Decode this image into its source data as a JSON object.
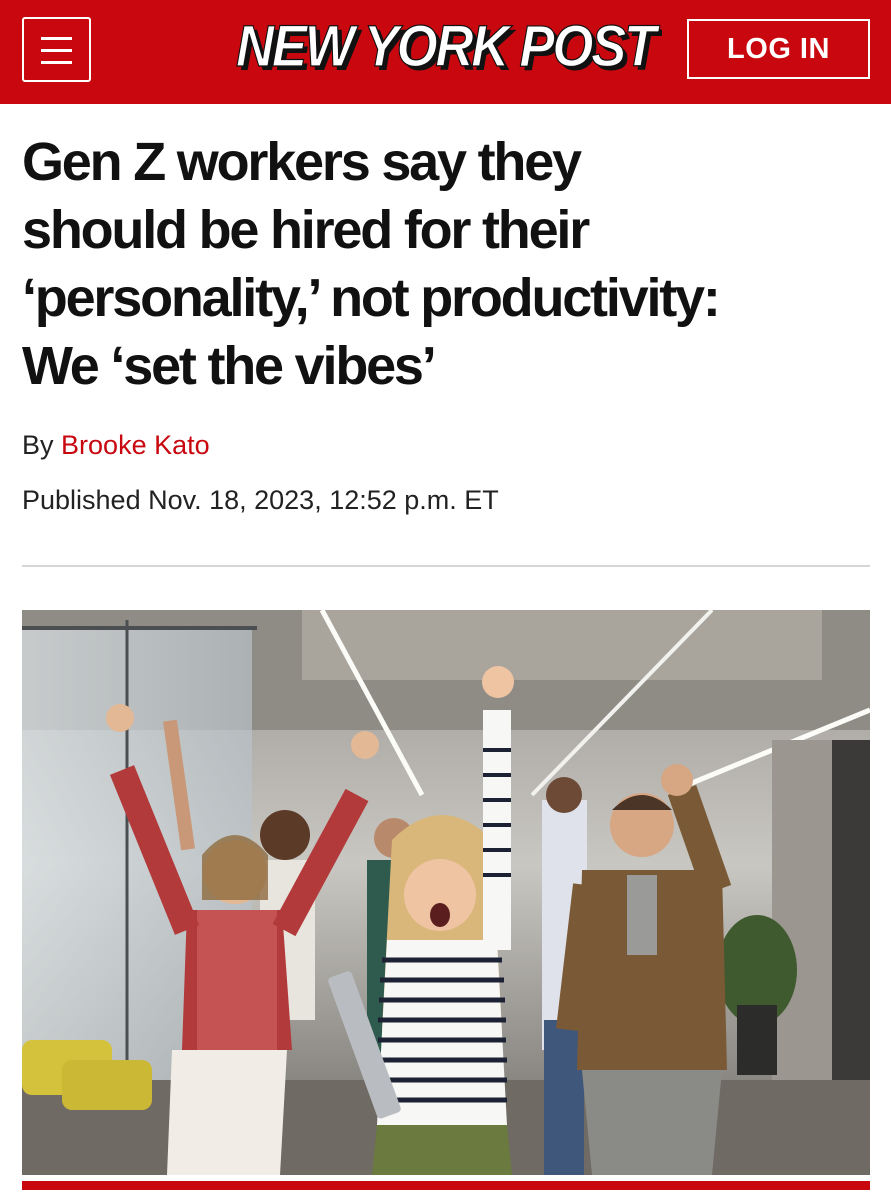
{
  "header": {
    "logo_text": "NEW YORK POST",
    "login_label": "LOG IN",
    "menu_icon": "hamburger-icon"
  },
  "article": {
    "headline_lines": [
      "Gen Z workers say they",
      "should be hired for their",
      "‘personality,’ not productivity:",
      "We ‘set the vibes’"
    ],
    "byline_prefix": "By",
    "author": "Brooke Kato",
    "published": "Published Nov. 18, 2023, 12:52 p.m. ET"
  },
  "colors": {
    "brand_red": "#c8070f",
    "text": "#111111",
    "divider": "#d6d6d6"
  }
}
